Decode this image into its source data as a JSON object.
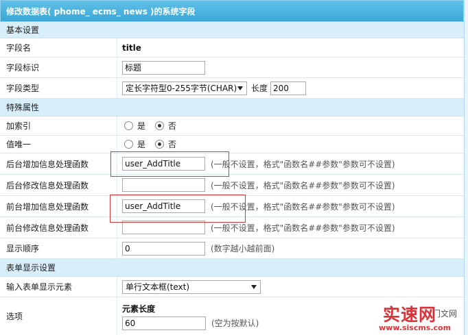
{
  "window": {
    "title": "修改数据表( phome_ ecms_ news )的系统字段"
  },
  "sections": {
    "basic": "基本设置",
    "special": "特殊属性",
    "form": "表单显示设置"
  },
  "fields": {
    "name": {
      "label": "字段名",
      "value": "title"
    },
    "tag": {
      "label": "字段标识",
      "value": "标题"
    },
    "type": {
      "label": "字段类型",
      "selected": "定长字符型0-255字节(CHAR)",
      "length_label": "长度",
      "length_value": "200"
    },
    "index": {
      "label": "加索引",
      "opt_yes": "是",
      "opt_no": "否",
      "selected": "否"
    },
    "unique": {
      "label": "值唯一",
      "opt_yes": "是",
      "opt_no": "否",
      "selected": "否"
    },
    "admin_add_fn": {
      "label": "后台增加信息处理函数",
      "value": "user_AddTitle",
      "hint": "(一般不设置，格式\"函数名##参数\"参数可不设置)"
    },
    "admin_edit_fn": {
      "label": "后台修改信息处理函数",
      "value": "",
      "hint": "(一般不设置，格式\"函数名##参数\"参数可不设置)"
    },
    "front_add_fn": {
      "label": "前台增加信息处理函数",
      "value": "user_AddTitle",
      "hint": "(一般不设置，格式\"函数名##参数\"参数可不设置)"
    },
    "front_edit_fn": {
      "label": "前台修改信息处理函数",
      "value": "",
      "hint": "(一般不设置，格式\"函数名##参数\"参数可不设置)"
    },
    "order": {
      "label": "显示顺序",
      "value": "0",
      "hint": "(数字越小越前面)"
    },
    "input_element": {
      "label": "输入表单显示元素",
      "selected": "单行文本框(text)"
    },
    "options": {
      "label": "选项",
      "sub_title": "元素长度",
      "value": "60",
      "hint": "(空为按默认)"
    }
  },
  "watermark": {
    "main": "实速网",
    "side": "门文网",
    "url": "www.siscms.com"
  },
  "colors": {
    "header": "#3aa7d7",
    "section_bg": "#d8eef9",
    "highlight_box": "#d23a3a"
  }
}
